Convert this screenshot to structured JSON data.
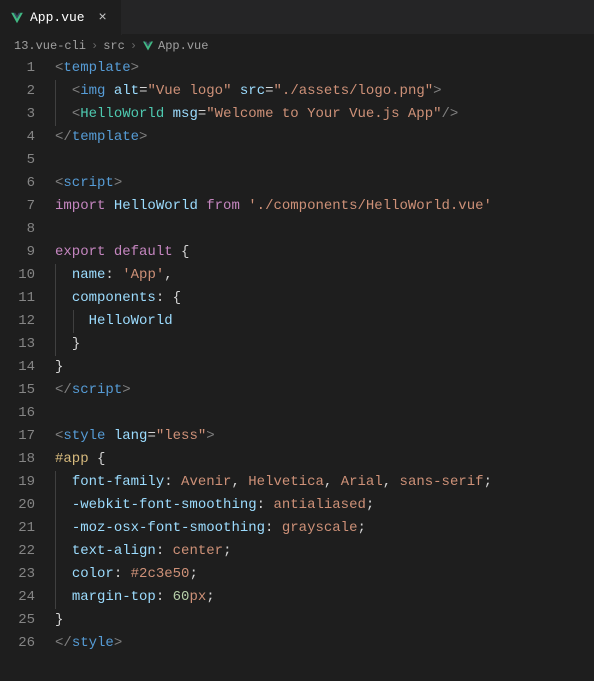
{
  "tab": {
    "filename": "App.vue",
    "close_glyph": "×"
  },
  "breadcrumb": {
    "items": [
      "13.vue-cli",
      "src",
      "App.vue"
    ],
    "sep": "›"
  },
  "lines": [
    {
      "n": 1,
      "indent": 0,
      "tokens": [
        {
          "c": "c-punct",
          "t": "<"
        },
        {
          "c": "c-tag",
          "t": "template"
        },
        {
          "c": "c-punct",
          "t": ">"
        }
      ]
    },
    {
      "n": 2,
      "indent": 1,
      "tokens": [
        {
          "c": "",
          "t": "  "
        },
        {
          "c": "c-punct",
          "t": "<"
        },
        {
          "c": "c-tag",
          "t": "img"
        },
        {
          "c": "",
          "t": " "
        },
        {
          "c": "c-attr",
          "t": "alt"
        },
        {
          "c": "c-white",
          "t": "="
        },
        {
          "c": "c-string",
          "t": "\"Vue logo\""
        },
        {
          "c": "",
          "t": " "
        },
        {
          "c": "c-attr",
          "t": "src"
        },
        {
          "c": "c-white",
          "t": "="
        },
        {
          "c": "c-string",
          "t": "\"./assets/logo.png\""
        },
        {
          "c": "c-punct",
          "t": ">"
        }
      ]
    },
    {
      "n": 3,
      "indent": 1,
      "tokens": [
        {
          "c": "",
          "t": "  "
        },
        {
          "c": "c-punct",
          "t": "<"
        },
        {
          "c": "c-class",
          "t": "HelloWorld"
        },
        {
          "c": "",
          "t": " "
        },
        {
          "c": "c-attr",
          "t": "msg"
        },
        {
          "c": "c-white",
          "t": "="
        },
        {
          "c": "c-string",
          "t": "\"Welcome to Your Vue.js App\""
        },
        {
          "c": "c-punct",
          "t": "/>"
        }
      ]
    },
    {
      "n": 4,
      "indent": 0,
      "tokens": [
        {
          "c": "c-punct",
          "t": "</"
        },
        {
          "c": "c-tag",
          "t": "template"
        },
        {
          "c": "c-punct",
          "t": ">"
        }
      ]
    },
    {
      "n": 5,
      "indent": 0,
      "tokens": []
    },
    {
      "n": 6,
      "indent": 0,
      "tokens": [
        {
          "c": "c-punct",
          "t": "<"
        },
        {
          "c": "c-tag",
          "t": "script"
        },
        {
          "c": "c-punct",
          "t": ">"
        }
      ]
    },
    {
      "n": 7,
      "indent": 0,
      "tokens": [
        {
          "c": "c-keyword",
          "t": "import"
        },
        {
          "c": "",
          "t": " "
        },
        {
          "c": "c-prop",
          "t": "HelloWorld"
        },
        {
          "c": "",
          "t": " "
        },
        {
          "c": "c-keyword",
          "t": "from"
        },
        {
          "c": "",
          "t": " "
        },
        {
          "c": "c-string",
          "t": "'./components/HelloWorld.vue'"
        }
      ]
    },
    {
      "n": 8,
      "indent": 0,
      "tokens": []
    },
    {
      "n": 9,
      "indent": 0,
      "tokens": [
        {
          "c": "c-keyword",
          "t": "export"
        },
        {
          "c": "",
          "t": " "
        },
        {
          "c": "c-keyword",
          "t": "default"
        },
        {
          "c": "",
          "t": " "
        },
        {
          "c": "c-white",
          "t": "{"
        }
      ]
    },
    {
      "n": 10,
      "indent": 1,
      "tokens": [
        {
          "c": "",
          "t": "  "
        },
        {
          "c": "c-prop",
          "t": "name"
        },
        {
          "c": "c-white",
          "t": ":"
        },
        {
          "c": "",
          "t": " "
        },
        {
          "c": "c-string",
          "t": "'App'"
        },
        {
          "c": "c-white",
          "t": ","
        }
      ]
    },
    {
      "n": 11,
      "indent": 1,
      "tokens": [
        {
          "c": "",
          "t": "  "
        },
        {
          "c": "c-prop",
          "t": "components"
        },
        {
          "c": "c-white",
          "t": ":"
        },
        {
          "c": "",
          "t": " "
        },
        {
          "c": "c-white",
          "t": "{"
        }
      ]
    },
    {
      "n": 12,
      "indent": 2,
      "tokens": [
        {
          "c": "",
          "t": "    "
        },
        {
          "c": "c-prop",
          "t": "HelloWorld"
        }
      ]
    },
    {
      "n": 13,
      "indent": 1,
      "tokens": [
        {
          "c": "",
          "t": "  "
        },
        {
          "c": "c-white",
          "t": "}"
        }
      ]
    },
    {
      "n": 14,
      "indent": 0,
      "tokens": [
        {
          "c": "c-white",
          "t": "}"
        }
      ]
    },
    {
      "n": 15,
      "indent": 0,
      "tokens": [
        {
          "c": "c-punct",
          "t": "</"
        },
        {
          "c": "c-tag",
          "t": "script"
        },
        {
          "c": "c-punct",
          "t": ">"
        }
      ]
    },
    {
      "n": 16,
      "indent": 0,
      "tokens": []
    },
    {
      "n": 17,
      "indent": 0,
      "tokens": [
        {
          "c": "c-punct",
          "t": "<"
        },
        {
          "c": "c-tag",
          "t": "style"
        },
        {
          "c": "",
          "t": " "
        },
        {
          "c": "c-attr",
          "t": "lang"
        },
        {
          "c": "c-white",
          "t": "="
        },
        {
          "c": "c-string",
          "t": "\"less\""
        },
        {
          "c": "c-punct",
          "t": ">"
        }
      ]
    },
    {
      "n": 18,
      "indent": 0,
      "tokens": [
        {
          "c": "c-sel",
          "t": "#app"
        },
        {
          "c": "",
          "t": " "
        },
        {
          "c": "c-white",
          "t": "{"
        }
      ]
    },
    {
      "n": 19,
      "indent": 1,
      "tokens": [
        {
          "c": "",
          "t": "  "
        },
        {
          "c": "c-prop",
          "t": "font-family"
        },
        {
          "c": "c-white",
          "t": ":"
        },
        {
          "c": "",
          "t": " "
        },
        {
          "c": "c-cssval",
          "t": "Avenir"
        },
        {
          "c": "c-white",
          "t": ","
        },
        {
          "c": "",
          "t": " "
        },
        {
          "c": "c-cssval",
          "t": "Helvetica"
        },
        {
          "c": "c-white",
          "t": ","
        },
        {
          "c": "",
          "t": " "
        },
        {
          "c": "c-cssval",
          "t": "Arial"
        },
        {
          "c": "c-white",
          "t": ","
        },
        {
          "c": "",
          "t": " "
        },
        {
          "c": "c-cssval",
          "t": "sans-serif"
        },
        {
          "c": "c-white",
          "t": ";"
        }
      ]
    },
    {
      "n": 20,
      "indent": 1,
      "tokens": [
        {
          "c": "",
          "t": "  "
        },
        {
          "c": "c-prop",
          "t": "-webkit-font-smoothing"
        },
        {
          "c": "c-white",
          "t": ":"
        },
        {
          "c": "",
          "t": " "
        },
        {
          "c": "c-cssval",
          "t": "antialiased"
        },
        {
          "c": "c-white",
          "t": ";"
        }
      ]
    },
    {
      "n": 21,
      "indent": 1,
      "tokens": [
        {
          "c": "",
          "t": "  "
        },
        {
          "c": "c-prop",
          "t": "-moz-osx-font-smoothing"
        },
        {
          "c": "c-white",
          "t": ":"
        },
        {
          "c": "",
          "t": " "
        },
        {
          "c": "c-cssval",
          "t": "grayscale"
        },
        {
          "c": "c-white",
          "t": ";"
        }
      ]
    },
    {
      "n": 22,
      "indent": 1,
      "tokens": [
        {
          "c": "",
          "t": "  "
        },
        {
          "c": "c-prop",
          "t": "text-align"
        },
        {
          "c": "c-white",
          "t": ":"
        },
        {
          "c": "",
          "t": " "
        },
        {
          "c": "c-cssval",
          "t": "center"
        },
        {
          "c": "c-white",
          "t": ";"
        }
      ]
    },
    {
      "n": 23,
      "indent": 1,
      "tokens": [
        {
          "c": "",
          "t": "  "
        },
        {
          "c": "c-prop",
          "t": "color"
        },
        {
          "c": "c-white",
          "t": ":"
        },
        {
          "c": "",
          "t": " "
        },
        {
          "c": "c-cssval",
          "t": "#2c3e50"
        },
        {
          "c": "c-white",
          "t": ";"
        }
      ]
    },
    {
      "n": 24,
      "indent": 1,
      "tokens": [
        {
          "c": "",
          "t": "  "
        },
        {
          "c": "c-prop",
          "t": "margin-top"
        },
        {
          "c": "c-white",
          "t": ":"
        },
        {
          "c": "",
          "t": " "
        },
        {
          "c": "c-num",
          "t": "60"
        },
        {
          "c": "c-cssval",
          "t": "px"
        },
        {
          "c": "c-white",
          "t": ";"
        }
      ]
    },
    {
      "n": 25,
      "indent": 0,
      "tokens": [
        {
          "c": "c-white",
          "t": "}"
        }
      ]
    },
    {
      "n": 26,
      "indent": 0,
      "tokens": [
        {
          "c": "c-punct",
          "t": "</"
        },
        {
          "c": "c-tag",
          "t": "style"
        },
        {
          "c": "c-punct",
          "t": ">"
        }
      ]
    }
  ]
}
